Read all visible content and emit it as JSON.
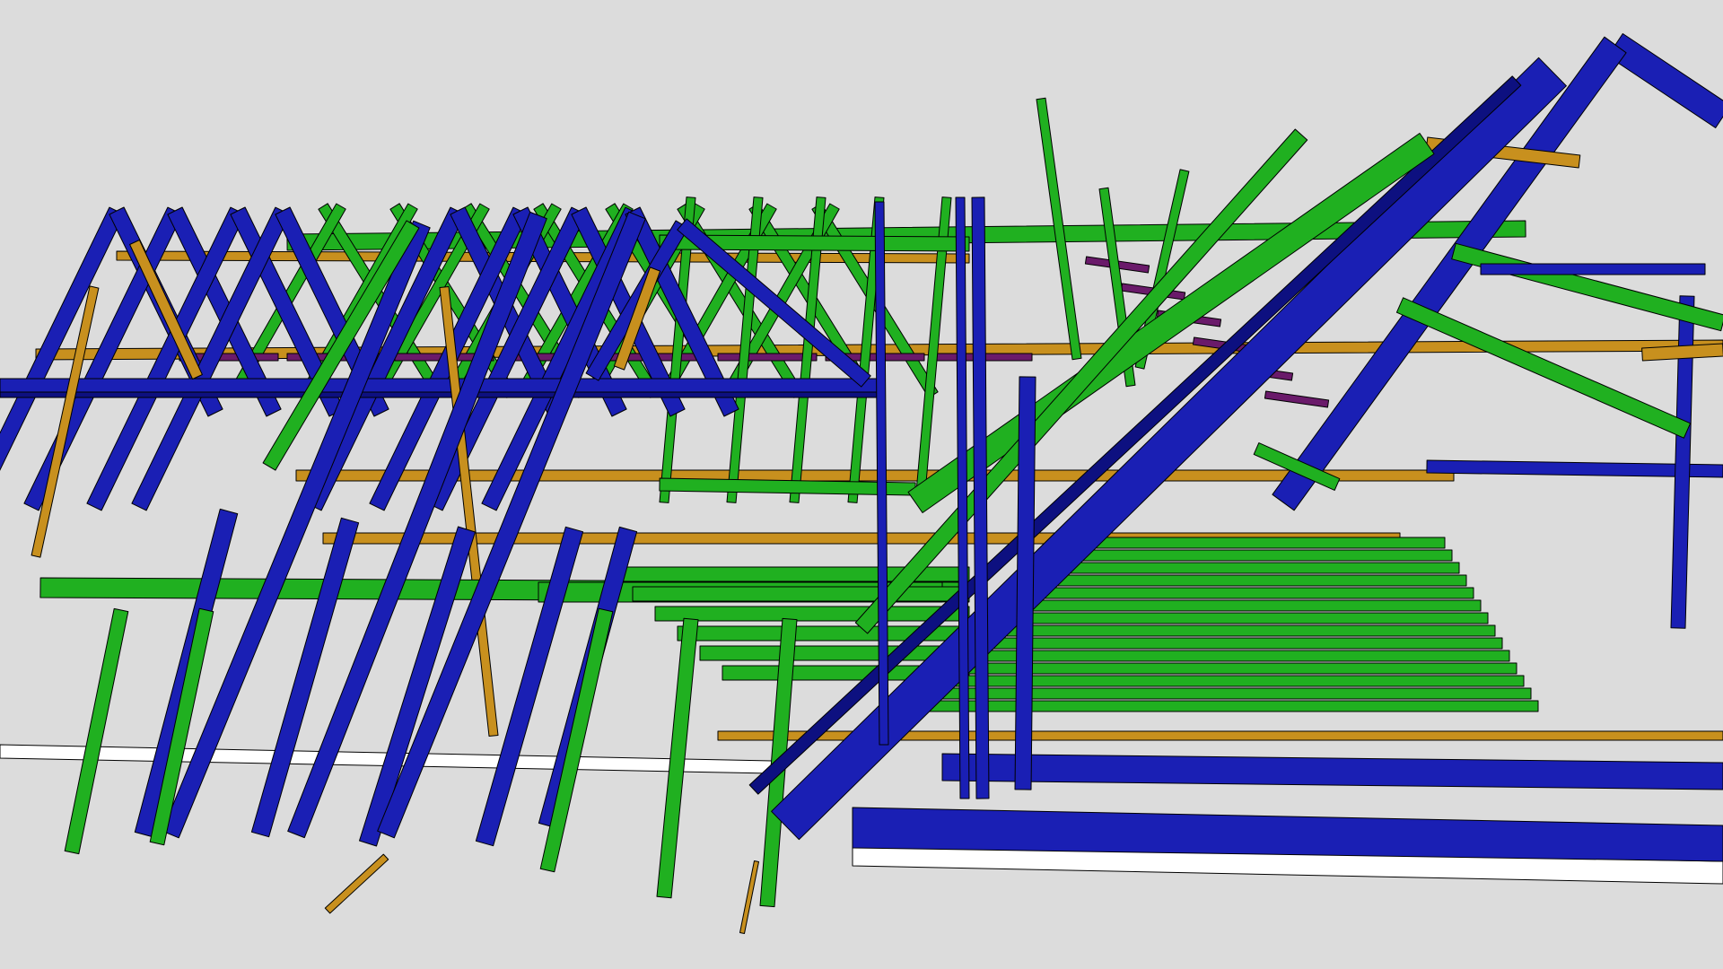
{
  "scene": {
    "description_free": true,
    "background": "#dcdcdc",
    "palette": {
      "rafter": "#1a1fb4",
      "rafter_dark": "#0d1080",
      "joist": "#20b020",
      "joist_dark": "#128012",
      "purlin": "#c8901e",
      "purlin_dark": "#8a6010",
      "brace": "#6a1a6a",
      "outline": "#000000",
      "base": "#ffffff"
    }
  }
}
